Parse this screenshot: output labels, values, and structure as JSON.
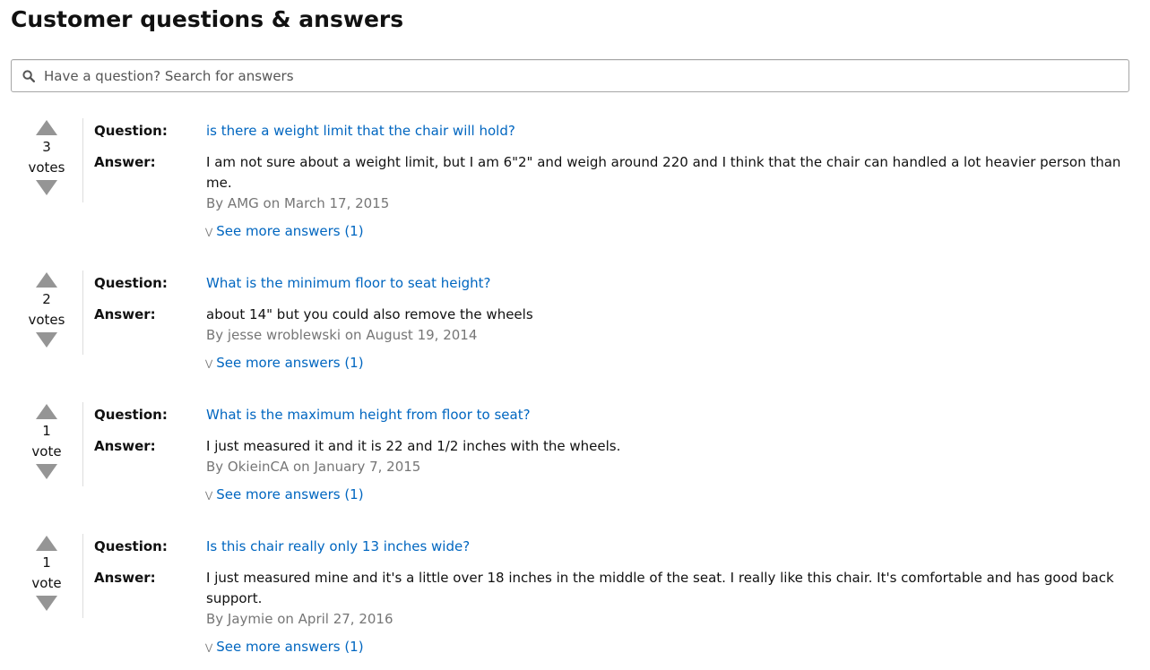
{
  "title": "Customer questions & answers",
  "search": {
    "placeholder": "Have a question? Search for answers",
    "value": ""
  },
  "icons": {
    "search": "search-icon",
    "vote_up": "triangle-up-icon",
    "vote_down": "triangle-down-icon",
    "see_more": "double-chevron-down-icon"
  },
  "colors": {
    "link": "#0066c0",
    "muted": "#767676",
    "vote_arrow": "#959595",
    "border": "#a6a6a6"
  },
  "labels": {
    "question": "Question:",
    "answer": "Answer:"
  },
  "questions": [
    {
      "votes": "3",
      "votes_label": "votes",
      "question": "is there a weight limit that the chair will hold?",
      "answer": "I am not sure about a weight limit, but I am 6\"2\" and weigh around 220 and I think that the chair can handled a lot heavier person than me.",
      "byline": "By AMG on March 17, 2015",
      "see_more": "See more answers (1)"
    },
    {
      "votes": "2",
      "votes_label": "votes",
      "question": "What is the minimum floor to seat height?",
      "answer": "about 14\" but you could also remove the wheels",
      "byline": "By jesse wroblewski on August 19, 2014",
      "see_more": "See more answers (1)"
    },
    {
      "votes": "1",
      "votes_label": "vote",
      "question": "What is the maximum height from floor to seat?",
      "answer": "I just measured it and it is 22 and 1/2 inches with the wheels.",
      "byline": "By OkieinCA on January 7, 2015",
      "see_more": "See more answers (1)"
    },
    {
      "votes": "1",
      "votes_label": "vote",
      "question": "Is this chair really only 13 inches wide?",
      "answer": "I just measured mine and it's a little over 18 inches in the middle of the seat. I really like this chair. It's comfortable and has good back support.",
      "byline": "By Jaymie on April 27, 2016",
      "see_more": "See more answers (1)"
    }
  ]
}
